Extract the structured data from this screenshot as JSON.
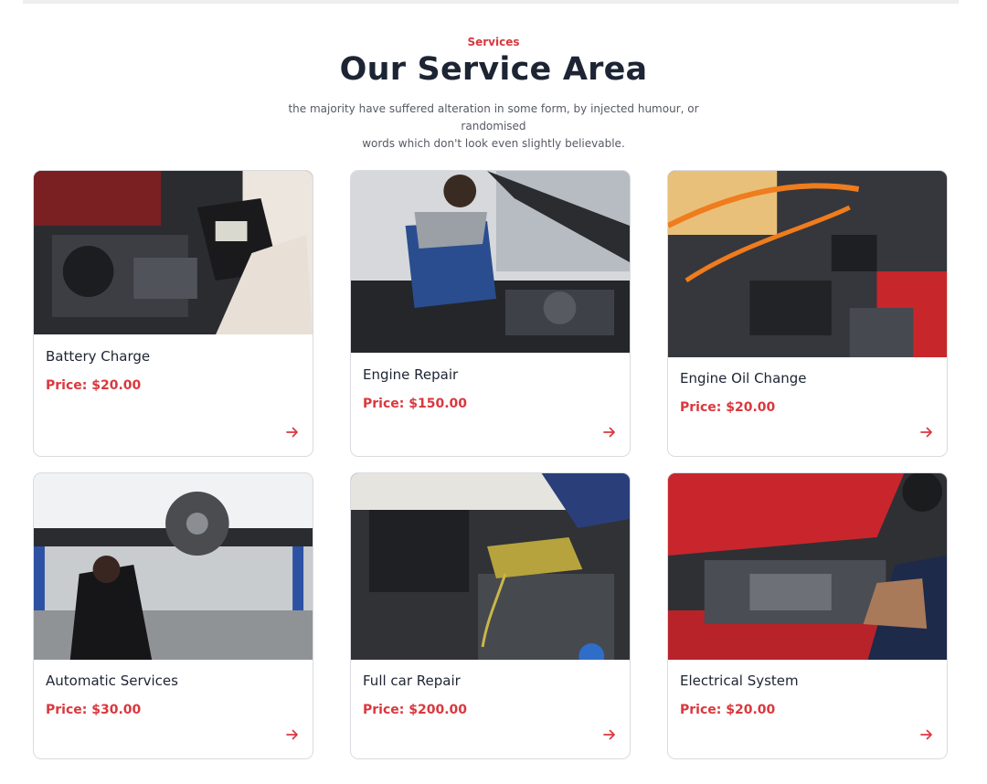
{
  "section": {
    "eyebrow": "Services",
    "title": "Our Service Area",
    "subtitle_line1": "the majority have suffered alteration in some form, by injected humour, or randomised",
    "subtitle_line2": "words which don't look even slightly believable."
  },
  "services": [
    {
      "name": "Battery Charge",
      "price": "Price: $20.00",
      "image": "battery-test-photo"
    },
    {
      "name": "Engine Repair",
      "price": "Price: $150.00",
      "image": "mechanic-engine-photo"
    },
    {
      "name": "Engine Oil Change",
      "price": "Price: $20.00",
      "image": "jumper-cables-photo"
    },
    {
      "name": "Automatic Services",
      "price": "Price: $30.00",
      "image": "brake-inspection-photo"
    },
    {
      "name": "Full car Repair",
      "price": "Price: $200.00",
      "image": "oil-pour-photo"
    },
    {
      "name": "Electrical System",
      "price": "Price: $20.00",
      "image": "electrical-engine-photo"
    }
  ],
  "colors": {
    "accent": "#d9383e",
    "heading": "#1d2433",
    "border": "#d9dbe0"
  },
  "icons": {
    "card_link": "arrow-right-icon"
  }
}
